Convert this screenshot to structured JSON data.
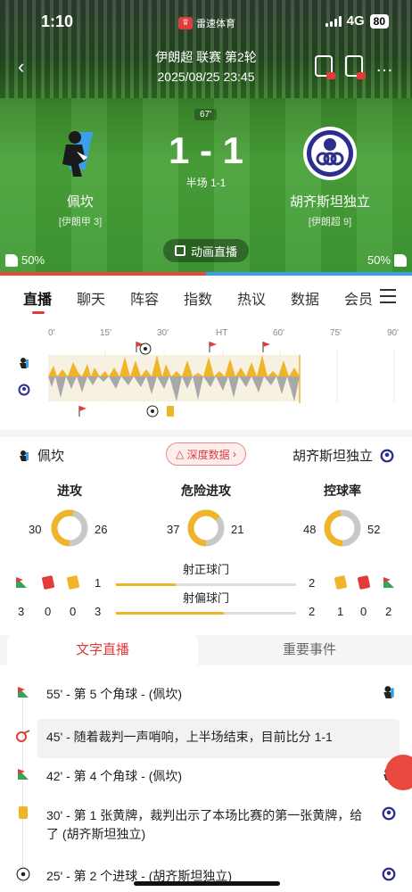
{
  "status_bar": {
    "time": "1:10",
    "app_name": "雷速体育",
    "network": "4G",
    "battery": "80"
  },
  "header": {
    "match_title": "伊朗超 联赛 第2轮",
    "datetime": "2025/08/25 23:45"
  },
  "scoreboard": {
    "minute": "67",
    "score": "1 - 1",
    "halftime": "半场 1-1",
    "home": {
      "name": "佩坎",
      "league": "[伊朗甲 3]"
    },
    "away": {
      "name": "胡齐斯坦独立",
      "league": "[伊朗超 9]"
    },
    "live_animation_label": "动画直播",
    "home_like_pct": "50%",
    "away_like_pct": "50%"
  },
  "tabs": [
    "直播",
    "聊天",
    "阵容",
    "指数",
    "热议",
    "数据",
    "会员"
  ],
  "timeline": {
    "ticks": [
      "0'",
      "15'",
      "30'",
      "HT",
      "60'",
      "75'",
      "90'"
    ]
  },
  "stats": {
    "home_name": "佩坎",
    "away_name": "胡齐斯坦独立",
    "deep_data_label": "深度数据",
    "donuts": [
      {
        "label": "进攻",
        "home": "30",
        "away": "26",
        "home_ratio": 0.536
      },
      {
        "label": "危险进攻",
        "home": "37",
        "away": "21",
        "home_ratio": 0.638
      },
      {
        "label": "控球率",
        "home": "48",
        "away": "52",
        "home_ratio": 0.48
      }
    ],
    "shots_on": {
      "label": "射正球门",
      "home": "1",
      "away": "2",
      "home_ratio": 0.333
    },
    "shots_off": {
      "label": "射偏球门",
      "home": "3",
      "away": "2",
      "home_ratio": 0.6
    },
    "home_counts": {
      "corners": "3",
      "red": "0",
      "yellow": "0"
    },
    "away_counts": {
      "yellow": "1",
      "red": "0",
      "corners": "2"
    }
  },
  "sub_tabs": {
    "active": "文字直播",
    "inactive": "重要事件"
  },
  "events": [
    {
      "text": "55' - 第 5 个角球 - (佩坎)"
    },
    {
      "text": "45' - 随着裁判一声哨响，上半场结束，目前比分 1-1"
    },
    {
      "text": "42' - 第 4 个角球 - (佩坎)"
    },
    {
      "text": "30' - 第 1 张黄牌，裁判出示了本场比赛的第一张黄牌，给了 (胡齐斯坦独立)"
    },
    {
      "text": "25' - 第 2 个进球 - (胡齐斯坦独立)"
    }
  ],
  "colors": {
    "accent": "#e23b3b",
    "attack": "#f0b429",
    "away_bar": "#3aa0e8"
  }
}
